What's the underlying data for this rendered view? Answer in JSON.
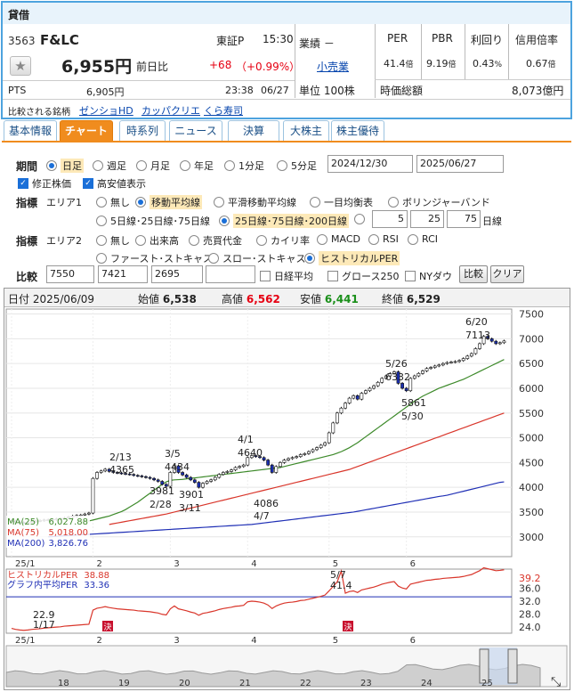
{
  "quote": {
    "market_type": "貸借",
    "code": "3563",
    "name": "F&LC",
    "exchange": "東証P",
    "time": "15:30",
    "price": "6,955円",
    "prev_label": "前日比",
    "change": "+68",
    "change_pct": "（+0.99%）",
    "pts_label": "PTS",
    "pts_price": "6,905円",
    "pts_time": "23:38",
    "pts_date": "06/27",
    "compare_label": "比較される銘柄",
    "compare_links": [
      "ゼンショHD",
      "カッパクリエ",
      "くら寿司"
    ],
    "gyoseki": "業績 －",
    "sector": "小売業",
    "unit": "単位 100株",
    "metrics": [
      {
        "label": "PER",
        "value": "41.4",
        "unit": "倍"
      },
      {
        "label": "PBR",
        "value": "9.19",
        "unit": "倍"
      },
      {
        "label": "利回り",
        "value": "0.43",
        "unit": "%"
      },
      {
        "label": "信用倍率",
        "value": "0.67",
        "unit": "倍"
      }
    ],
    "market_cap_label": "時価総額",
    "market_cap": "8,073億円"
  },
  "tabs": [
    "基本情報",
    "チャート",
    "時系列",
    "ニュース",
    "決算",
    "大株主",
    "株主優待"
  ],
  "controls": {
    "period_label": "期間",
    "periods": [
      "日足",
      "週足",
      "月足",
      "年足",
      "1分足",
      "5分足"
    ],
    "date_from": "2024/12/30",
    "date_to": "2025/06/27",
    "adjusted": "修正株価",
    "high_low": "高安値表示",
    "indicator_label": "指標",
    "area1_label": "エリア1",
    "area1_options": [
      "無し",
      "移動平均線",
      "平滑移動平均線",
      "一目均衡表",
      "ボリンジャーバンド"
    ],
    "ma_set_a": "5日線･25日線･75日線",
    "ma_set_b": "25日線･75日線･200日線",
    "ma_custom": [
      "5",
      "25",
      "75"
    ],
    "ma_custom_unit": "日線",
    "area2_label": "エリア2",
    "area2_row1": [
      "無し",
      "出来高",
      "売買代金",
      "カイリ率",
      "MACD",
      "RSI",
      "RCI"
    ],
    "area2_row2": [
      "ファースト･ストキャス",
      "スロー･ストキャス",
      "ヒストリカルPER"
    ],
    "compare_label": "比較",
    "compare_codes": [
      "7550",
      "7421",
      "2695",
      ""
    ],
    "compare_checks": [
      "日経平均",
      "グロース250",
      "NYダウ"
    ],
    "compare_btn": "比較",
    "clear_btn": "クリア"
  },
  "chart_data": {
    "type": "candlestick",
    "info": {
      "date_label": "日付",
      "date": "2025/06/09",
      "open_label": "始値",
      "open": "6,538",
      "high_label": "高値",
      "high": "6,562",
      "low_label": "安値",
      "low": "6,441",
      "close_label": "終値",
      "close": "6,529"
    },
    "ylim": [
      2600,
      7600
    ],
    "y_ticks": [
      "7500",
      "7000",
      "6500",
      "6000",
      "5500",
      "5000",
      "4500",
      "4000",
      "3500",
      "3000"
    ],
    "x_month_labels": [
      "25/1",
      "2",
      "3",
      "4",
      "5",
      "6"
    ],
    "month_start_index": [
      0,
      20,
      39,
      58,
      78,
      97
    ],
    "closes": [
      3320,
      3300,
      3290,
      3285,
      3295,
      3310,
      3320,
      3330,
      3340,
      3345,
      3350,
      3360,
      3370,
      3380,
      3400,
      3420,
      3430,
      3440,
      3460,
      3480,
      4180,
      4300,
      4330,
      4365,
      4320,
      4300,
      4290,
      4280,
      4270,
      4260,
      4240,
      4230,
      4215,
      4200,
      4180,
      4150,
      4120,
      4060,
      4020,
      4300,
      4434,
      4300,
      4250,
      4200,
      4150,
      4100,
      4000,
      4080,
      4120,
      4150,
      4200,
      4260,
      4300,
      4320,
      4350,
      4400,
      4420,
      4450,
      4600,
      4640,
      4620,
      4600,
      4550,
      4450,
      4300,
      4420,
      4500,
      4550,
      4580,
      4600,
      4620,
      4660,
      4680,
      4720,
      4760,
      4800,
      4850,
      4900,
      5100,
      5300,
      5500,
      5600,
      5700,
      5800,
      5850,
      5780,
      5900,
      5950,
      6000,
      6050,
      6120,
      6200,
      6250,
      6300,
      6332,
      6100,
      6000,
      5950,
      6200,
      6250,
      6300,
      6350,
      6400,
      6420,
      6450,
      6470,
      6500,
      6520,
      6529,
      6540,
      6560,
      6600,
      6650,
      6700,
      6800,
      6900,
      7050,
      7000,
      6950,
      6900,
      6920,
      6955
    ],
    "ma25_label": "MA(25)",
    "ma25_value": "6,027.88",
    "ma75_label": "MA(75)",
    "ma75_value": "5,018.00",
    "ma200_label": "MA(200)",
    "ma200_value": "3,826.76",
    "ma25": [
      3300,
      3310,
      3320,
      3340,
      3360,
      3380,
      3400,
      3420,
      3450,
      3480,
      3510,
      3550,
      3600,
      3650,
      3700,
      3760,
      3820,
      3880,
      3940,
      4000,
      4060,
      4110,
      4140,
      4150,
      4155,
      4160,
      4170,
      4180,
      4190,
      4200,
      4210,
      4220,
      4230,
      4240,
      4250,
      4260,
      4270,
      4280,
      4290,
      4300,
      4310,
      4320,
      4330,
      4340,
      4350,
      4360,
      4370,
      4380,
      4390,
      4400,
      4420,
      4440,
      4460,
      4480,
      4500,
      4520,
      4540,
      4560,
      4580,
      4600,
      4620,
      4640,
      4660,
      4690,
      4720,
      4760,
      4800,
      4850,
      4900,
      4960,
      5020,
      5080,
      5140,
      5200,
      5260,
      5320,
      5380,
      5440,
      5500,
      5560,
      5620,
      5680,
      5740,
      5790,
      5840,
      5880,
      5920,
      5960,
      6000,
      6030,
      6060,
      6090,
      6120,
      6150,
      6180,
      6220,
      6260,
      6300,
      6340,
      6380,
      6420,
      6460,
      6500,
      6540,
      6580
    ],
    "ma75": [
      3250,
      3265,
      3280,
      3295,
      3310,
      3325,
      3340,
      3355,
      3370,
      3385,
      3400,
      3415,
      3430,
      3445,
      3460,
      3480,
      3500,
      3520,
      3540,
      3560,
      3580,
      3600,
      3620,
      3640,
      3660,
      3680,
      3700,
      3720,
      3740,
      3760,
      3780,
      3800,
      3820,
      3840,
      3860,
      3880,
      3900,
      3920,
      3940,
      3960,
      3980,
      4000,
      4020,
      4040,
      4060,
      4080,
      4100,
      4120,
      4140,
      4160,
      4180,
      4200,
      4220,
      4240,
      4260,
      4280,
      4300,
      4320,
      4340,
      4360,
      4390,
      4420,
      4450,
      4480,
      4510,
      4540,
      4570,
      4600,
      4630,
      4660,
      4690,
      4720,
      4750,
      4780,
      4810,
      4840,
      4870,
      4900,
      4930,
      4960,
      4990,
      5018,
      5050,
      5080,
      5110,
      5140,
      5170,
      5200,
      5230,
      5260,
      5290,
      5320,
      5350,
      5380,
      5410,
      5440,
      5470,
      5500
    ],
    "ma200": [
      3000,
      3005,
      3010,
      3015,
      3020,
      3025,
      3030,
      3035,
      3040,
      3045,
      3050,
      3055,
      3060,
      3065,
      3070,
      3075,
      3080,
      3085,
      3090,
      3095,
      3100,
      3105,
      3110,
      3115,
      3120,
      3125,
      3130,
      3135,
      3140,
      3145,
      3150,
      3155,
      3160,
      3165,
      3170,
      3175,
      3180,
      3185,
      3190,
      3195,
      3200,
      3205,
      3210,
      3215,
      3220,
      3225,
      3230,
      3235,
      3240,
      3245,
      3250,
      3260,
      3270,
      3280,
      3290,
      3300,
      3310,
      3320,
      3330,
      3340,
      3350,
      3360,
      3370,
      3380,
      3390,
      3400,
      3410,
      3420,
      3430,
      3440,
      3450,
      3460,
      3470,
      3480,
      3490,
      3500,
      3515,
      3530,
      3545,
      3560,
      3575,
      3590,
      3605,
      3620,
      3635,
      3650,
      3665,
      3680,
      3695,
      3710,
      3725,
      3740,
      3755,
      3770,
      3785,
      3800,
      3815,
      3826,
      3840,
      3860,
      3880,
      3900,
      3920,
      3940,
      3960,
      3980,
      4000,
      4020,
      4040,
      4060,
      4080,
      4100,
      4110
    ],
    "annotations": [
      {
        "text": "2/13",
        "value": "4365"
      },
      {
        "text": "3/5",
        "value": "4434"
      },
      {
        "text": "4/1",
        "value": "4640"
      },
      {
        "text": "5/26",
        "value": "6332"
      },
      {
        "text": "6/20",
        "value": "7113"
      },
      {
        "text": "3981",
        "value": "2/28"
      },
      {
        "text": "3901",
        "value": "3/11"
      },
      {
        "text": "4086",
        "value": "4/7"
      },
      {
        "text": "5861",
        "value": "5/30"
      }
    ],
    "per": {
      "label1": "ヒストリカルPER",
      "value1": "38.88",
      "label2": "グラフ内平均PER",
      "value2": "33.36",
      "ylim": [
        22,
        42
      ],
      "y_ticks": [
        "39.2",
        "36.0",
        "32.0",
        "28.0",
        "24.0"
      ],
      "annotations": [
        {
          "text": "22.9",
          "value": "1/17"
        },
        {
          "text": "5/7",
          "value": "41.4"
        }
      ],
      "kessan_label": "決",
      "values": [
        23.5,
        23.2,
        23.0,
        22.9,
        23.0,
        23.2,
        23.3,
        23.4,
        23.6,
        23.7,
        23.8,
        23.9,
        24.0,
        24.2,
        24.3,
        24.4,
        24.5,
        24.6,
        24.7,
        24.8,
        29.2,
        29.8,
        30.0,
        30.3,
        30.0,
        29.8,
        29.6,
        29.5,
        29.4,
        29.3,
        29.2,
        29.0,
        28.9,
        28.8,
        28.7,
        28.5,
        28.3,
        27.9,
        27.7,
        29.6,
        30.5,
        29.6,
        29.3,
        29.0,
        28.6,
        28.3,
        27.6,
        28.2,
        28.4,
        28.7,
        29.0,
        29.4,
        29.7,
        29.9,
        30.1,
        30.4,
        30.5,
        30.7,
        31.8,
        32.0,
        31.9,
        31.7,
        31.4,
        30.8,
        29.7,
        30.5,
        31.0,
        31.4,
        31.6,
        31.7,
        31.9,
        32.2,
        32.3,
        32.6,
        32.9,
        33.2,
        33.5,
        33.9,
        35.2,
        36.6,
        38.0,
        41.4,
        34.5,
        35.0,
        35.2,
        34.7,
        35.5,
        35.8,
        36.1,
        36.4,
        36.8,
        37.3,
        37.6,
        37.9,
        38.1,
        36.7,
        36.1,
        35.8,
        37.3,
        37.6,
        37.9,
        38.2,
        38.5,
        38.6,
        38.8,
        38.9,
        39.1,
        39.2,
        39.3,
        39.4,
        39.5,
        39.7,
        40.0,
        40.3,
        40.9,
        41.5,
        42.4,
        42.1,
        41.8,
        41.5,
        41.6,
        41.8
      ],
      "x_month_labels": [
        "25/1",
        "2",
        "3",
        "4",
        "5",
        "6"
      ]
    },
    "navigator_labels": [
      "18",
      "19",
      "20",
      "21",
      "22",
      "23",
      "24",
      "25"
    ]
  }
}
